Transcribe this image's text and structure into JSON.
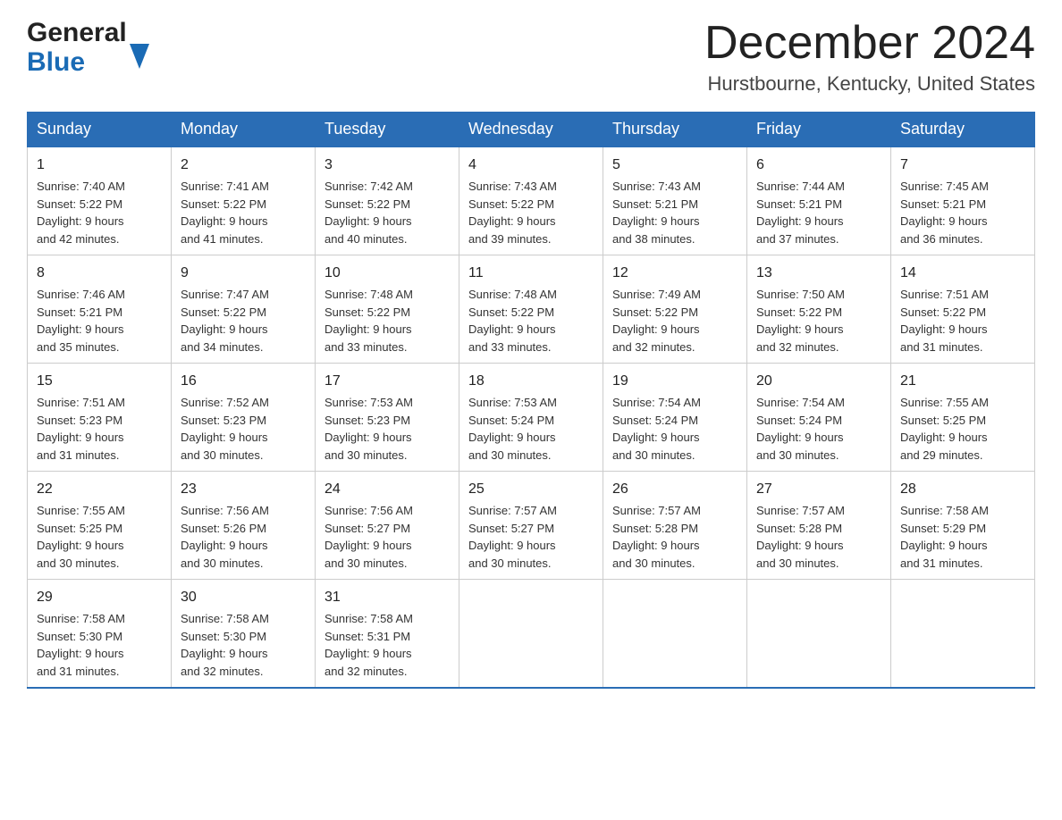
{
  "header": {
    "logo_general": "General",
    "logo_blue": "Blue",
    "month_title": "December 2024",
    "location": "Hurstbourne, Kentucky, United States"
  },
  "weekdays": [
    "Sunday",
    "Monday",
    "Tuesday",
    "Wednesday",
    "Thursday",
    "Friday",
    "Saturday"
  ],
  "weeks": [
    [
      {
        "day": "1",
        "sunrise": "7:40 AM",
        "sunset": "5:22 PM",
        "daylight": "9 hours and 42 minutes."
      },
      {
        "day": "2",
        "sunrise": "7:41 AM",
        "sunset": "5:22 PM",
        "daylight": "9 hours and 41 minutes."
      },
      {
        "day": "3",
        "sunrise": "7:42 AM",
        "sunset": "5:22 PM",
        "daylight": "9 hours and 40 minutes."
      },
      {
        "day": "4",
        "sunrise": "7:43 AM",
        "sunset": "5:22 PM",
        "daylight": "9 hours and 39 minutes."
      },
      {
        "day": "5",
        "sunrise": "7:43 AM",
        "sunset": "5:21 PM",
        "daylight": "9 hours and 38 minutes."
      },
      {
        "day": "6",
        "sunrise": "7:44 AM",
        "sunset": "5:21 PM",
        "daylight": "9 hours and 37 minutes."
      },
      {
        "day": "7",
        "sunrise": "7:45 AM",
        "sunset": "5:21 PM",
        "daylight": "9 hours and 36 minutes."
      }
    ],
    [
      {
        "day": "8",
        "sunrise": "7:46 AM",
        "sunset": "5:21 PM",
        "daylight": "9 hours and 35 minutes."
      },
      {
        "day": "9",
        "sunrise": "7:47 AM",
        "sunset": "5:22 PM",
        "daylight": "9 hours and 34 minutes."
      },
      {
        "day": "10",
        "sunrise": "7:48 AM",
        "sunset": "5:22 PM",
        "daylight": "9 hours and 33 minutes."
      },
      {
        "day": "11",
        "sunrise": "7:48 AM",
        "sunset": "5:22 PM",
        "daylight": "9 hours and 33 minutes."
      },
      {
        "day": "12",
        "sunrise": "7:49 AM",
        "sunset": "5:22 PM",
        "daylight": "9 hours and 32 minutes."
      },
      {
        "day": "13",
        "sunrise": "7:50 AM",
        "sunset": "5:22 PM",
        "daylight": "9 hours and 32 minutes."
      },
      {
        "day": "14",
        "sunrise": "7:51 AM",
        "sunset": "5:22 PM",
        "daylight": "9 hours and 31 minutes."
      }
    ],
    [
      {
        "day": "15",
        "sunrise": "7:51 AM",
        "sunset": "5:23 PM",
        "daylight": "9 hours and 31 minutes."
      },
      {
        "day": "16",
        "sunrise": "7:52 AM",
        "sunset": "5:23 PM",
        "daylight": "9 hours and 30 minutes."
      },
      {
        "day": "17",
        "sunrise": "7:53 AM",
        "sunset": "5:23 PM",
        "daylight": "9 hours and 30 minutes."
      },
      {
        "day": "18",
        "sunrise": "7:53 AM",
        "sunset": "5:24 PM",
        "daylight": "9 hours and 30 minutes."
      },
      {
        "day": "19",
        "sunrise": "7:54 AM",
        "sunset": "5:24 PM",
        "daylight": "9 hours and 30 minutes."
      },
      {
        "day": "20",
        "sunrise": "7:54 AM",
        "sunset": "5:24 PM",
        "daylight": "9 hours and 30 minutes."
      },
      {
        "day": "21",
        "sunrise": "7:55 AM",
        "sunset": "5:25 PM",
        "daylight": "9 hours and 29 minutes."
      }
    ],
    [
      {
        "day": "22",
        "sunrise": "7:55 AM",
        "sunset": "5:25 PM",
        "daylight": "9 hours and 30 minutes."
      },
      {
        "day": "23",
        "sunrise": "7:56 AM",
        "sunset": "5:26 PM",
        "daylight": "9 hours and 30 minutes."
      },
      {
        "day": "24",
        "sunrise": "7:56 AM",
        "sunset": "5:27 PM",
        "daylight": "9 hours and 30 minutes."
      },
      {
        "day": "25",
        "sunrise": "7:57 AM",
        "sunset": "5:27 PM",
        "daylight": "9 hours and 30 minutes."
      },
      {
        "day": "26",
        "sunrise": "7:57 AM",
        "sunset": "5:28 PM",
        "daylight": "9 hours and 30 minutes."
      },
      {
        "day": "27",
        "sunrise": "7:57 AM",
        "sunset": "5:28 PM",
        "daylight": "9 hours and 30 minutes."
      },
      {
        "day": "28",
        "sunrise": "7:58 AM",
        "sunset": "5:29 PM",
        "daylight": "9 hours and 31 minutes."
      }
    ],
    [
      {
        "day": "29",
        "sunrise": "7:58 AM",
        "sunset": "5:30 PM",
        "daylight": "9 hours and 31 minutes."
      },
      {
        "day": "30",
        "sunrise": "7:58 AM",
        "sunset": "5:30 PM",
        "daylight": "9 hours and 32 minutes."
      },
      {
        "day": "31",
        "sunrise": "7:58 AM",
        "sunset": "5:31 PM",
        "daylight": "9 hours and 32 minutes."
      },
      null,
      null,
      null,
      null
    ]
  ],
  "labels": {
    "sunrise": "Sunrise:",
    "sunset": "Sunset:",
    "daylight": "Daylight:"
  }
}
